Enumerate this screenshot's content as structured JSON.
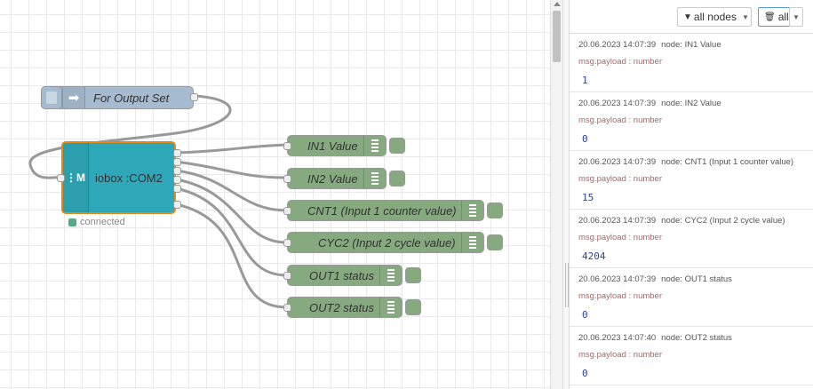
{
  "flow": {
    "inject_node": {
      "label": "For Output Set"
    },
    "iobox_node": {
      "label": "iobox :COM2",
      "status": "connected"
    },
    "debug_nodes": [
      {
        "label": "IN1 Value"
      },
      {
        "label": "IN2 Value"
      },
      {
        "label": "CNT1 (Input 1 counter value)"
      },
      {
        "label": "CYC2 (Input 2 cycle value)"
      },
      {
        "label": "OUT1 status"
      },
      {
        "label": "OUT2 status"
      }
    ],
    "colors": {
      "inject": "#a6bbcf",
      "iobox": "#2ea8b8",
      "debug": "#87a980",
      "status_dot": "#5a8",
      "wire": "#999"
    }
  },
  "sidebar": {
    "filter_label": "all nodes",
    "clear_label": "all",
    "messages": [
      {
        "timestamp": "20.06.2023 14:07:39",
        "node": "node: IN1 Value",
        "type": "msg.payload : number",
        "value": "1"
      },
      {
        "timestamp": "20.06.2023 14:07:39",
        "node": "node: IN2 Value",
        "type": "msg.payload : number",
        "value": "0"
      },
      {
        "timestamp": "20.06.2023 14:07:39",
        "node": "node: CNT1 (Input 1 counter value)",
        "type": "msg.payload : number",
        "value": "15"
      },
      {
        "timestamp": "20.06.2023 14:07:39",
        "node": "node: CYC2 (Input 2 cycle value)",
        "type": "msg.payload : number",
        "value": "4204"
      },
      {
        "timestamp": "20.06.2023 14:07:39",
        "node": "node: OUT1 status",
        "type": "msg.payload : number",
        "value": "0"
      },
      {
        "timestamp": "20.06.2023 14:07:40",
        "node": "node: OUT2 status",
        "type": "msg.payload : number",
        "value": "0"
      }
    ]
  }
}
